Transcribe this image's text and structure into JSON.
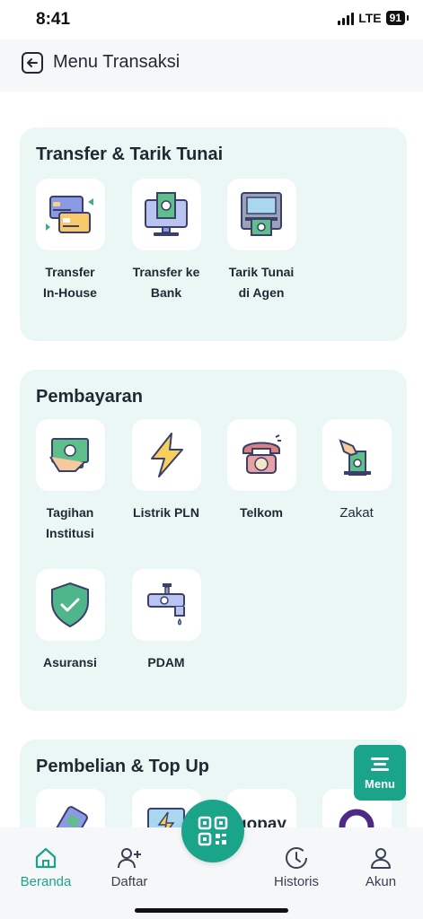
{
  "status": {
    "time": "8:41",
    "network": "LTE",
    "battery": "91"
  },
  "header": {
    "title": "Menu Transaksi"
  },
  "sections": [
    {
      "title": "Transfer & Tarik Tunai",
      "items": [
        {
          "label": "Transfer\nIn-House",
          "icon": "transfer-cards-icon"
        },
        {
          "label": "Transfer ke\nBank",
          "icon": "monitor-money-icon"
        },
        {
          "label": "Tarik Tunai\ndi Agen",
          "icon": "atm-icon"
        }
      ]
    },
    {
      "title": "Pembayaran",
      "items": [
        {
          "label": "Tagihan\nInstitusi",
          "icon": "hand-money-icon"
        },
        {
          "label": "Listrik PLN",
          "icon": "lightning-icon"
        },
        {
          "label": "Telkom",
          "icon": "telephone-icon"
        },
        {
          "label": "Zakat",
          "icon": "donation-box-icon"
        },
        {
          "label": "Asuransi",
          "icon": "shield-check-icon"
        },
        {
          "label": "PDAM",
          "icon": "water-tap-icon"
        }
      ]
    },
    {
      "title": "Pembelian & Top Up",
      "items": [
        {
          "label": "",
          "icon": "phone-credit-icon"
        },
        {
          "label": "",
          "icon": "electric-token-icon"
        },
        {
          "label": "gopay",
          "icon": "gopay-logo"
        },
        {
          "label": "",
          "icon": "ovo-logo"
        }
      ]
    }
  ],
  "menu_fab": {
    "label": "Menu"
  },
  "bottom_nav": [
    {
      "label": "Beranda",
      "icon": "home-icon",
      "active": true
    },
    {
      "label": "Daftar",
      "icon": "add-user-icon",
      "active": false
    },
    {
      "label": "Historis",
      "icon": "history-clock-icon",
      "active": false
    },
    {
      "label": "Akun",
      "icon": "user-icon",
      "active": false
    }
  ],
  "colors": {
    "accent": "#1aa58b",
    "card_bg": "#ebf7f5",
    "header_bg": "#f6f7f9",
    "text": "#1f2933"
  }
}
